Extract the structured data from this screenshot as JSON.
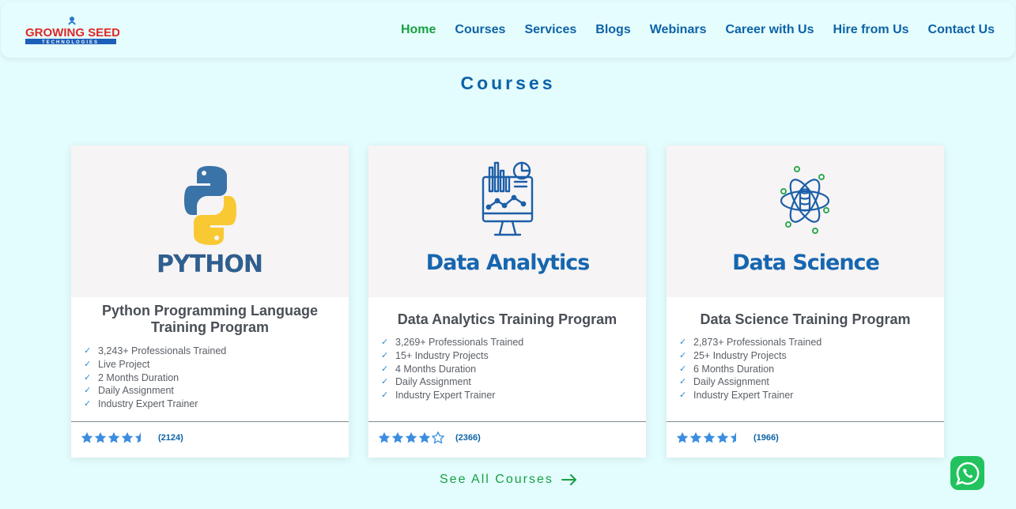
{
  "logo": {
    "line1": "GROWING SEED",
    "line2": "TECHNOLOGIES"
  },
  "nav": {
    "items": [
      {
        "label": "Home",
        "active": true
      },
      {
        "label": "Courses",
        "active": false
      },
      {
        "label": "Services",
        "active": false
      },
      {
        "label": "Blogs",
        "active": false
      },
      {
        "label": "Webinars",
        "active": false
      },
      {
        "label": "Career with Us",
        "active": false
      },
      {
        "label": "Hire from Us",
        "active": false
      },
      {
        "label": "Contact Us",
        "active": false
      }
    ]
  },
  "section": {
    "title": "Courses"
  },
  "courses": [
    {
      "banner_text": "PYTHON",
      "icon": "python-logo-icon",
      "title": "Python Programming Language Training Program",
      "features": [
        "3,243+ Professionals Trained",
        "Live Project",
        "2 Months Duration",
        "Daily Assignment",
        "Industry Expert Trainer"
      ],
      "rating": 4.5,
      "reviews": "(2124)"
    },
    {
      "banner_text": "Data Analytics",
      "icon": "analytics-monitor-icon",
      "title": "Data Analytics Training Program",
      "features": [
        "3,269+ Professionals Trained",
        "15+ Industry Projects",
        "4 Months Duration",
        "Daily Assignment",
        "Industry Expert Trainer"
      ],
      "rating": 4,
      "reviews": "(2366)"
    },
    {
      "banner_text": "Data Science",
      "icon": "atom-database-icon",
      "title": "Data Science Training Program",
      "features": [
        "2,873+ Professionals Trained",
        "25+ Industry Projects",
        "6 Months Duration",
        "Daily Assignment",
        "Industry Expert Trainer"
      ],
      "rating": 4.5,
      "reviews": "(1966)"
    }
  ],
  "see_all": {
    "label": "See All Courses"
  },
  "colors": {
    "brand_blue": "#0c63a8",
    "brand_green": "#17a043",
    "star_blue": "#3b8de0",
    "background": "#e3fcfd"
  }
}
